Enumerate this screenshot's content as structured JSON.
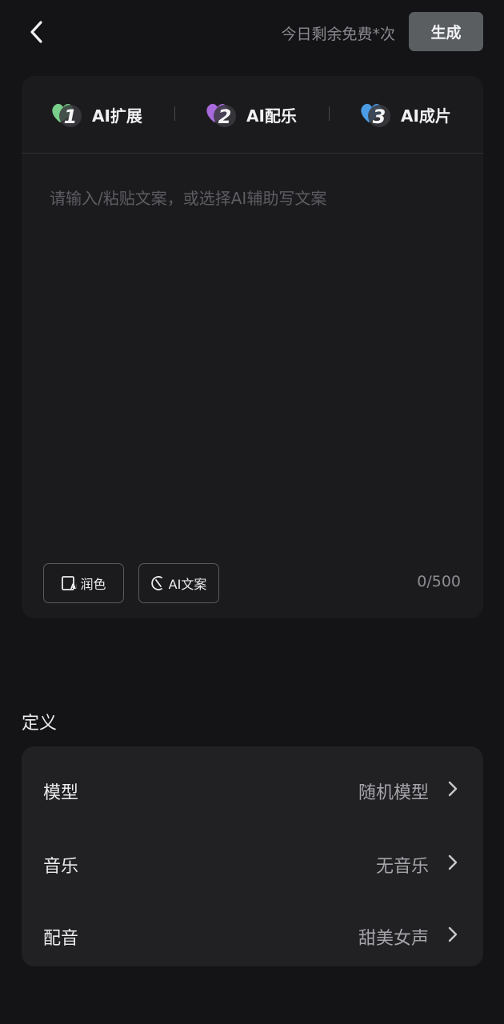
{
  "header": {
    "back_icon": "chevron-left-icon",
    "quota_text": "今日剩余免费*次",
    "generate_label": "生成"
  },
  "steps": [
    {
      "number": "1",
      "label": "AI扩展",
      "icon": "heart-1-icon",
      "color": "#7ed88f"
    },
    {
      "number": "2",
      "label": "AI配乐",
      "icon": "heart-2-icon",
      "color": "#b06ee8"
    },
    {
      "number": "3",
      "label": "AI成片",
      "icon": "heart-3-icon",
      "color": "#4ea3f0"
    }
  ],
  "editor": {
    "placeholder": "请输入/粘贴文案，或选择AI辅助写文案",
    "value": "",
    "polish_label": "润色",
    "ai_copy_label": "AI文案",
    "counter": "0/500"
  },
  "definition": {
    "title": "定义",
    "rows": [
      {
        "label": "模型",
        "value": "随机模型"
      },
      {
        "label": "音乐",
        "value": "无音乐"
      },
      {
        "label": "配音",
        "value": "甜美女声"
      }
    ]
  },
  "colors": {
    "background": "#141416",
    "card": "#1b1b1d",
    "settings_card": "#212123",
    "generate_button": "#5b5e61"
  }
}
